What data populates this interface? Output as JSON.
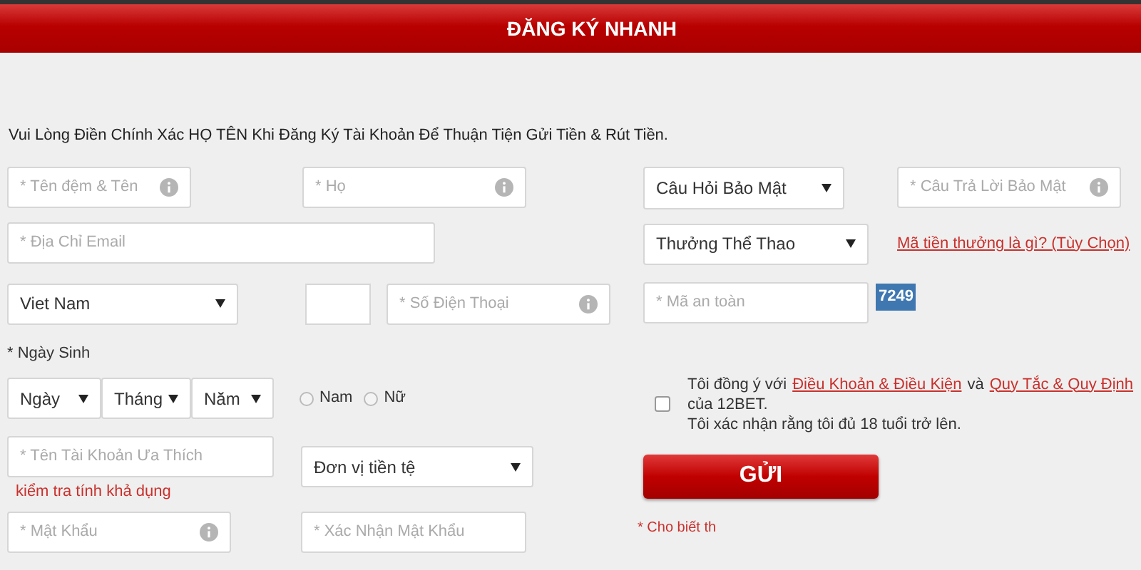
{
  "header": {
    "title": "ĐĂNG KÝ NHANH"
  },
  "intro": "Vui Lòng Điền Chính Xác HỌ TÊN Khi Đăng Ký Tài Khoản Để Thuận Tiện Gửi Tiền & Rút Tiền.",
  "left": {
    "first_name": {
      "placeholder": "* Tên đệm & Tên",
      "info": true
    },
    "last_name": {
      "placeholder": "* Họ",
      "info": true
    },
    "email": {
      "placeholder": "* Địa Chỉ Email",
      "info": false
    },
    "country": {
      "value": "Viet Nam"
    },
    "phone": {
      "placeholder": "* Số Điện Thoại",
      "info": true
    },
    "birth_label": "* Ngày Sinh",
    "birth": [
      {
        "value": "Ngày"
      },
      {
        "value": "Tháng"
      },
      {
        "value": "Năm"
      }
    ],
    "gender": [
      {
        "label": "Nam",
        "selected": false
      },
      {
        "label": "Nữ",
        "selected": false
      }
    ],
    "username": {
      "placeholder": "* Tên Tài Khoản Ưa Thích",
      "info": false
    },
    "check_link": "kiểm tra tính khả dụng",
    "currency": {
      "value": "Đơn vị tiền tệ"
    },
    "password": {
      "placeholder": "* Mật Khẩu",
      "info": true
    },
    "confirm": {
      "placeholder": "* Xác Nhận Mật Khẩu",
      "info": false
    }
  },
  "right": {
    "question": {
      "value": "Câu Hỏi Bảo Mật"
    },
    "answer": {
      "placeholder": "* Câu Trả Lời Bảo Mật",
      "info": true
    },
    "bonus": {
      "value": "Thưởng Thể Thao"
    },
    "bonus_link": "Mã tiền thưởng là gì? (Tùy Chọn)",
    "captcha_field": {
      "placeholder": "* Mã an toàn",
      "info": false
    },
    "captcha": "7249",
    "agree": {
      "checked": false,
      "text_before": "Tôi đồng ý với",
      "link1": "Điều Khoản & Điều Kiện",
      "and": "và",
      "link2": "Quy Tắc & Quy Định",
      "text_after": "của 12BET.",
      "line2": "Tôi xác nhận rằng tôi đủ 18 tuổi trở lên."
    },
    "submit": "GỬI",
    "note": "* Cho biết th"
  }
}
